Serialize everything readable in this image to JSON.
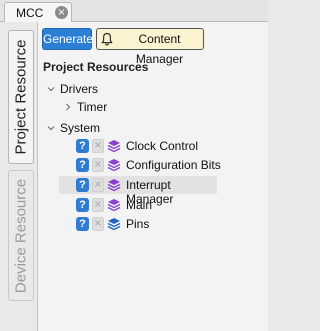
{
  "tab": {
    "label": "MCC",
    "close_symbol": "×"
  },
  "side_tabs": {
    "project_resource": "Project Resource",
    "device_resource": "Device Resource"
  },
  "toolbar": {
    "generate_label": "Generate",
    "content_manager_label": "Content Manager"
  },
  "section_title": "Project Resources",
  "tree": {
    "drivers": {
      "label": "Drivers",
      "children": [
        "Timer"
      ]
    },
    "system": {
      "label": "System",
      "items": [
        {
          "label": "Clock Control",
          "icon": "purple-layers-icon"
        },
        {
          "label": "Configuration Bits",
          "icon": "purple-layers-icon"
        },
        {
          "label": "Interrupt Manager",
          "icon": "purple-layers-icon",
          "selected": true
        },
        {
          "label": "Main",
          "icon": "purple-layers-icon"
        },
        {
          "label": "Pins",
          "icon": "blue-layers-icon"
        }
      ]
    }
  },
  "icons": {
    "help_symbol": "?",
    "remove_symbol": "×"
  },
  "colors": {
    "generate_button": "#2b7fd4",
    "content_manager_button": "#fbf2cf",
    "help_icon": "#2f7bd3",
    "purple_layers": "#8a3fd1",
    "blue_layers": "#2563c9"
  }
}
